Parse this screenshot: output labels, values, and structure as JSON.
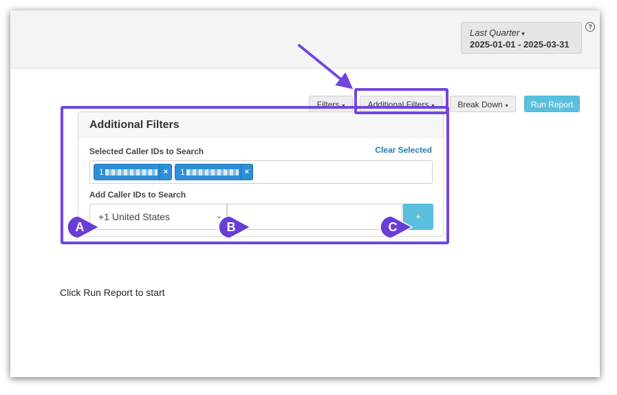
{
  "date_range": {
    "preset_label": "Last Quarter",
    "range": "2025-01-01 - 2025-03-31"
  },
  "help_icon": {
    "glyph": "?"
  },
  "toolbar": {
    "filters_label": "Filters",
    "additional_filters_label": "Additional Filters",
    "break_down_label": "Break Down",
    "run_report_label": "Run Report",
    "caret": "▾"
  },
  "panel": {
    "title": "Additional Filters",
    "selected_label": "Selected Caller IDs to Search",
    "clear_selected": "Clear Selected",
    "tags": [
      {
        "prefix": "1",
        "remove": "×"
      },
      {
        "prefix": "1",
        "remove": "×"
      }
    ],
    "add_label": "Add Caller IDs to Search",
    "country_value": "+1 United States",
    "country_chevron": "⌄",
    "phone_value": "",
    "add_button": "+"
  },
  "markers": [
    "A",
    "B",
    "C"
  ],
  "empty_message": "Click Run Report to start",
  "colors": {
    "highlight": "#7245e0",
    "primary": "#5bc0de",
    "tag": "#2d8fd6",
    "link": "#2a7ab0"
  }
}
